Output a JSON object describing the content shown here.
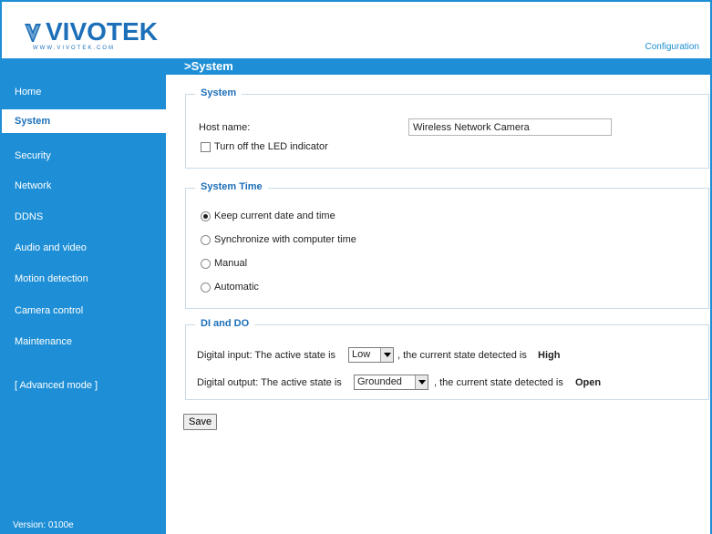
{
  "header": {
    "logo_text": "VIVOTEK",
    "logo_sub": "WWW.VIVOTEK.COM",
    "config_link": "Configuration"
  },
  "sidebar": {
    "items": [
      {
        "label": "Home"
      },
      {
        "label": "System"
      },
      {
        "label": "Security"
      },
      {
        "label": "Network"
      },
      {
        "label": "DDNS"
      },
      {
        "label": "Audio and video"
      },
      {
        "label": "Motion detection"
      },
      {
        "label": "Camera control"
      },
      {
        "label": "Maintenance"
      },
      {
        "label": "[ Advanced mode ]"
      }
    ],
    "version": "Version: 0100e"
  },
  "page_title": ">System",
  "system": {
    "legend": "System",
    "host_name_label": "Host name:",
    "host_name_value": "Wireless Network Camera",
    "led_label": "Turn off the LED indicator",
    "led_checked": false
  },
  "system_time": {
    "legend": "System Time",
    "options": [
      {
        "label": "Keep current date and time",
        "checked": true
      },
      {
        "label": "Synchronize with computer time",
        "checked": false
      },
      {
        "label": "Manual",
        "checked": false
      },
      {
        "label": "Automatic",
        "checked": false
      }
    ]
  },
  "dio": {
    "legend": "DI and DO",
    "digital_input": {
      "prefix": "Digital input: The active state is",
      "selected": "Low",
      "suffix": ", the current state detected is",
      "state": "High"
    },
    "digital_output": {
      "prefix": "Digital output: The active state is",
      "selected": "Grounded",
      "suffix": ", the current state detected is",
      "state": "Open"
    }
  },
  "save_label": "Save",
  "colors": {
    "accent": "#1e8fd6",
    "brand": "#1c6fb8"
  }
}
